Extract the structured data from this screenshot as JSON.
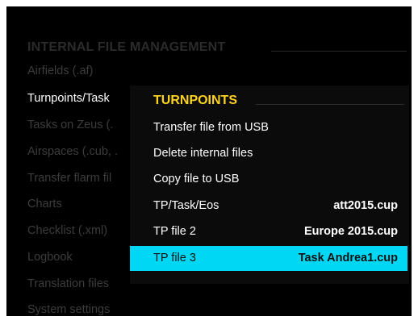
{
  "background_menu": {
    "title": "INTERNAL FILE MANAGEMENT",
    "items": [
      {
        "label": "Airfields (.af)"
      },
      {
        "label": "Turnpoints/Task"
      },
      {
        "label": "Tasks on Zeus (."
      },
      {
        "label": "Airspaces (.cub, ."
      },
      {
        "label": "Transfer flarm fil"
      },
      {
        "label": "Charts"
      },
      {
        "label": "Checklist (.xml)"
      },
      {
        "label": "Logbook"
      },
      {
        "label": "Translation files"
      },
      {
        "label": "System settings"
      }
    ],
    "active_item": "Turnpoints/Task"
  },
  "popup": {
    "title": "TURNPOINTS",
    "items": [
      {
        "label": "Transfer file from USB",
        "value": ""
      },
      {
        "label": "Delete internal files",
        "value": ""
      },
      {
        "label": "Copy file to USB",
        "value": ""
      },
      {
        "label": "TP/Task/Eos",
        "value": "att2015.cup"
      },
      {
        "label": "TP file 2",
        "value": "Europe 2015.cup"
      },
      {
        "label": "TP file 3",
        "value": "Task Andrea1.cup"
      }
    ],
    "selected_item": "TP file 3"
  },
  "colors": {
    "background": "#000000",
    "title_accent": "#ffd21e",
    "selection": "#00d7f5"
  }
}
